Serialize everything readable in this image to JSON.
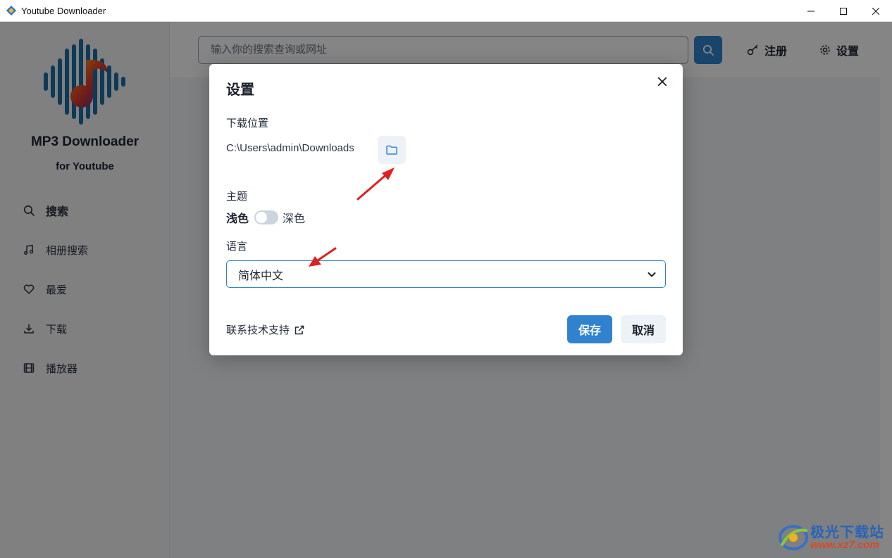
{
  "window": {
    "title": "Youtube Downloader"
  },
  "sidebar": {
    "brand_title": "MP3 Downloader",
    "brand_subtitle": "for Youtube",
    "items": [
      {
        "label": "搜索",
        "icon": "search-icon",
        "active": true
      },
      {
        "label": "相册搜索",
        "icon": "music-note-icon",
        "active": false
      },
      {
        "label": "最爱",
        "icon": "heart-icon",
        "active": false
      },
      {
        "label": "下载",
        "icon": "download-icon",
        "active": false
      },
      {
        "label": "播放器",
        "icon": "film-icon",
        "active": false
      }
    ]
  },
  "header": {
    "search_placeholder": "输入你的搜索查询或网址",
    "register_label": "注册",
    "settings_label": "设置"
  },
  "dialog": {
    "title": "设置",
    "download_location_label": "下载位置",
    "download_path": "C:\\Users\\admin\\Downloads",
    "theme_label": "主题",
    "theme_light": "浅色",
    "theme_dark": "深色",
    "theme_dark_enabled": false,
    "language_label": "语言",
    "language_value": "简体中文",
    "support_link": "联系技术支持",
    "save_label": "保存",
    "cancel_label": "取消"
  },
  "watermark": {
    "line1": "极光下载站",
    "line2": "www.xz7.com"
  },
  "colors": {
    "accent": "#3182ce",
    "annotation_arrow": "#e02020"
  }
}
